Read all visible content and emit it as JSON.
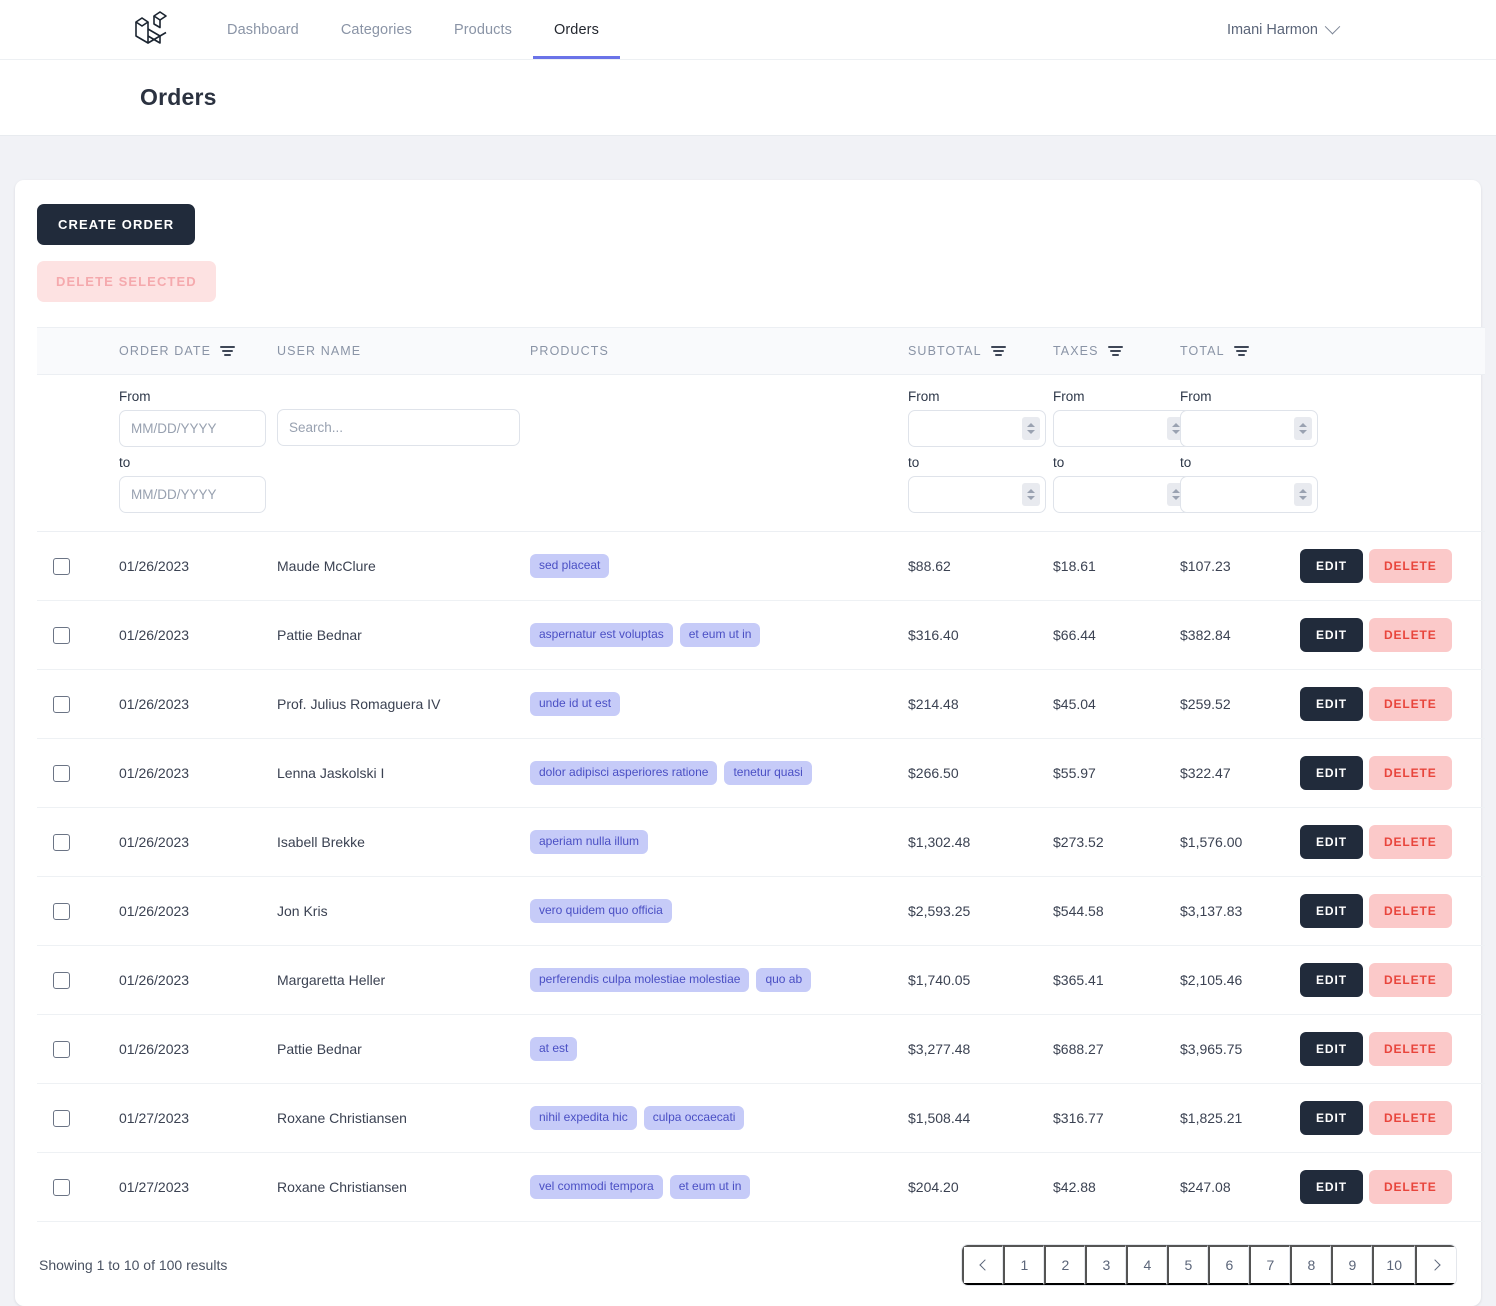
{
  "nav": {
    "brand_icon": "laravel-logo",
    "links": [
      {
        "label": "Dashboard",
        "active": false
      },
      {
        "label": "Categories",
        "active": false
      },
      {
        "label": "Products",
        "active": false
      },
      {
        "label": "Orders",
        "active": true
      }
    ],
    "user": {
      "name": "Imani Harmon",
      "caret_icon": "chevron-down-icon"
    }
  },
  "header": {
    "title": "Orders"
  },
  "toolbar": {
    "create_label": "CREATE ORDER",
    "delete_selected_label": "DELETE SELECTED"
  },
  "table": {
    "columns": [
      {
        "key": "checkbox",
        "label": "",
        "filterable": false
      },
      {
        "key": "order_date",
        "label": "ORDER DATE",
        "filterable": true
      },
      {
        "key": "user_name",
        "label": "USER NAME",
        "filterable": false
      },
      {
        "key": "products",
        "label": "PRODUCTS",
        "filterable": false
      },
      {
        "key": "subtotal",
        "label": "SUBTOTAL",
        "filterable": true
      },
      {
        "key": "taxes",
        "label": "TAXES",
        "filterable": true
      },
      {
        "key": "total",
        "label": "TOTAL",
        "filterable": true
      },
      {
        "key": "actions",
        "label": "",
        "filterable": false
      }
    ],
    "filters": {
      "from_label": "From",
      "to_label": "to",
      "date_placeholder": "MM/DD/YYYY",
      "date_from_value": "",
      "date_to_value": "",
      "search_placeholder": "Search...",
      "search_value": "",
      "subtotal_from": "",
      "subtotal_to": "",
      "taxes_from": "",
      "taxes_to": "",
      "total_from": "",
      "total_to": ""
    },
    "row_actions": {
      "edit_label": "EDIT",
      "delete_label": "DELETE"
    },
    "rows": [
      {
        "date": "01/26/2023",
        "user": "Maude McClure",
        "products": [
          "sed placeat"
        ],
        "subtotal": "$88.62",
        "taxes": "$18.61",
        "total": "$107.23"
      },
      {
        "date": "01/26/2023",
        "user": "Pattie Bednar",
        "products": [
          "aspernatur est voluptas",
          "et eum ut in"
        ],
        "subtotal": "$316.40",
        "taxes": "$66.44",
        "total": "$382.84"
      },
      {
        "date": "01/26/2023",
        "user": "Prof. Julius Romaguera IV",
        "products": [
          "unde id ut est"
        ],
        "subtotal": "$214.48",
        "taxes": "$45.04",
        "total": "$259.52"
      },
      {
        "date": "01/26/2023",
        "user": "Lenna Jaskolski I",
        "products": [
          "dolor adipisci asperiores ratione",
          "tenetur quasi"
        ],
        "subtotal": "$266.50",
        "taxes": "$55.97",
        "total": "$322.47"
      },
      {
        "date": "01/26/2023",
        "user": "Isabell Brekke",
        "products": [
          "aperiam nulla illum"
        ],
        "subtotal": "$1,302.48",
        "taxes": "$273.52",
        "total": "$1,576.00"
      },
      {
        "date": "01/26/2023",
        "user": "Jon Kris",
        "products": [
          "vero quidem quo officia"
        ],
        "subtotal": "$2,593.25",
        "taxes": "$544.58",
        "total": "$3,137.83"
      },
      {
        "date": "01/26/2023",
        "user": "Margaretta Heller",
        "products": [
          "perferendis culpa molestiae molestiae",
          "quo ab"
        ],
        "subtotal": "$1,740.05",
        "taxes": "$365.41",
        "total": "$2,105.46"
      },
      {
        "date": "01/26/2023",
        "user": "Pattie Bednar",
        "products": [
          "at est"
        ],
        "subtotal": "$3,277.48",
        "taxes": "$688.27",
        "total": "$3,965.75"
      },
      {
        "date": "01/27/2023",
        "user": "Roxane Christiansen",
        "products": [
          "nihil expedita hic",
          "culpa occaecati"
        ],
        "subtotal": "$1,508.44",
        "taxes": "$316.77",
        "total": "$1,825.21"
      },
      {
        "date": "01/27/2023",
        "user": "Roxane Christiansen",
        "products": [
          "vel commodi tempora",
          "et eum ut in"
        ],
        "subtotal": "$204.20",
        "taxes": "$42.88",
        "total": "$247.08"
      }
    ]
  },
  "footer": {
    "showing_text": "Showing 1 to 10 of 100 results",
    "pagination": {
      "prev_icon": "chevron-left-icon",
      "next_icon": "chevron-right-icon",
      "pages": [
        "1",
        "2",
        "3",
        "4",
        "5",
        "6",
        "7",
        "8",
        "9",
        "10"
      ],
      "current": "1"
    }
  },
  "colors": {
    "accent": "#6a73e8",
    "dark_button": "#212b3b",
    "danger_bg": "#fbc9c9",
    "danger_text": "#e8453c",
    "tag_bg": "#c6cbf8",
    "tag_text": "#4a4fc4",
    "page_bg": "#f1f2f6"
  }
}
